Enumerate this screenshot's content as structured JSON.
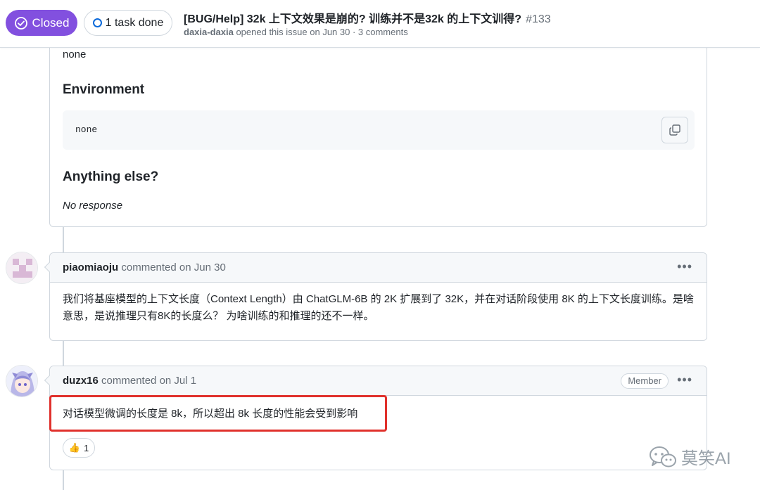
{
  "header": {
    "state_label": "Closed",
    "task_label": "1 task done",
    "title": "[BUG/Help] 32k 上下文效果是崩的? 训练并不是32k 的上下文训得?",
    "number": "#133",
    "author": "daxia-daxia",
    "meta_text": "opened this issue on Jun 30 · 3 comments",
    "colors": {
      "closed": "#8250df",
      "task_ring": "#0969da"
    }
  },
  "issue_body": {
    "top_text": "none",
    "environment_heading": "Environment",
    "environment_code": "none",
    "anything_else_heading": "Anything else?",
    "anything_else_text": "No response"
  },
  "comments": [
    {
      "author": "piaomiaoju",
      "action": "commented on Jun 30",
      "body": "我们将基座模型的上下文长度（Context Length）由 ChatGLM-6B 的 2K 扩展到了 32K，并在对话阶段使用 8K 的上下文长度训练。是啥意思，是说推理只有8K的长度么？ 为啥训练的和推理的还不一样。",
      "avatar_icon": "identicon-avatar"
    },
    {
      "author": "duzx16",
      "action": "commented on Jul 1",
      "badge": "Member",
      "body": "对话模型微调的长度是 8k，所以超出 8k 长度的性能会受到影响",
      "reaction_emoji": "👍",
      "reaction_count": "1",
      "avatar_icon": "anime-avatar"
    }
  ],
  "watermark": {
    "text": "莫笑AI",
    "icon": "wechat-icon"
  }
}
